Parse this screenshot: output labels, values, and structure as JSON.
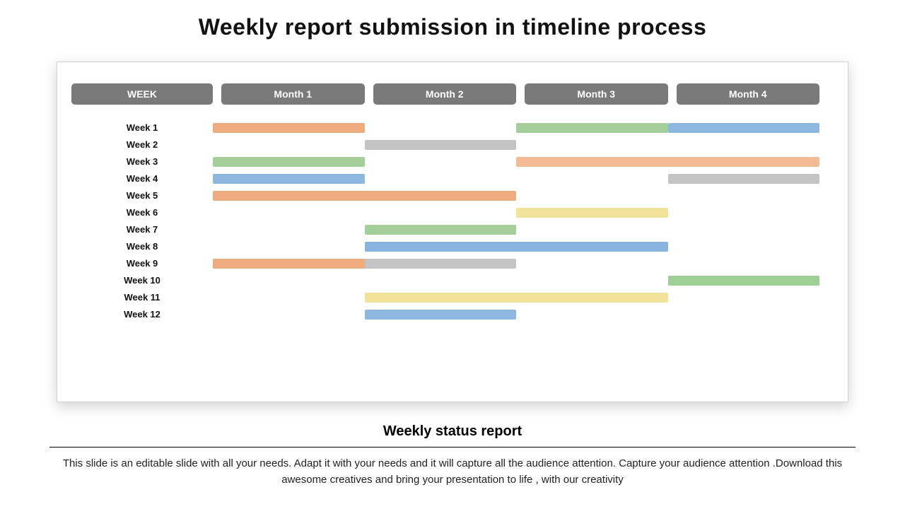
{
  "title": "Weekly report submission in timeline process",
  "headers": {
    "week": "WEEK",
    "m1": "Month 1",
    "m2": "Month 2",
    "m3": "Month 3",
    "m4": "Month 4"
  },
  "weeks": [
    "Week 1",
    "Week 2",
    "Week 3",
    "Week 4",
    "Week 5",
    "Week 6",
    "Week 7",
    "Week 8",
    "Week 9",
    "Week 10",
    "Week 11",
    "Week 12"
  ],
  "subtitle": "Weekly status report",
  "description": "This slide is an editable slide with all your needs. Adapt it with your needs and it will capture all the audience attention. Capture your audience attention .Download this awesome creatives and bring your presentation to life , with our creativity",
  "chart_data": {
    "type": "bar",
    "title": "Weekly report submission in timeline process",
    "xlabel": "",
    "ylabel": "",
    "xlim": [
      0,
      4
    ],
    "categories": [
      "Week 1",
      "Week 2",
      "Week 3",
      "Week 4",
      "Week 5",
      "Week 6",
      "Week 7",
      "Week 8",
      "Week 9",
      "Week 10",
      "Week 11",
      "Week 12"
    ],
    "columns": [
      "Month 1",
      "Month 2",
      "Month 3",
      "Month 4"
    ],
    "series": [
      {
        "name": "Week 1",
        "bars": [
          {
            "start": 0.0,
            "end": 1.0,
            "color": "orange"
          },
          {
            "start": 2.0,
            "end": 3.0,
            "color": "green"
          },
          {
            "start": 3.0,
            "end": 4.0,
            "color": "blue"
          }
        ]
      },
      {
        "name": "Week 2",
        "bars": [
          {
            "start": 1.0,
            "end": 2.0,
            "color": "gray"
          }
        ]
      },
      {
        "name": "Week 3",
        "bars": [
          {
            "start": 0.0,
            "end": 1.0,
            "color": "green"
          },
          {
            "start": 2.0,
            "end": 4.0,
            "color": "orange"
          }
        ]
      },
      {
        "name": "Week 4",
        "bars": [
          {
            "start": 0.0,
            "end": 1.0,
            "color": "blue"
          },
          {
            "start": 3.0,
            "end": 4.0,
            "color": "gray"
          }
        ]
      },
      {
        "name": "Week 5",
        "bars": [
          {
            "start": 0.0,
            "end": 2.0,
            "color": "orange"
          }
        ]
      },
      {
        "name": "Week 6",
        "bars": [
          {
            "start": 2.0,
            "end": 3.0,
            "color": "yellow"
          }
        ]
      },
      {
        "name": "Week 7",
        "bars": [
          {
            "start": 1.0,
            "end": 2.0,
            "color": "green"
          }
        ]
      },
      {
        "name": "Week 8",
        "bars": [
          {
            "start": 1.0,
            "end": 3.0,
            "color": "blue"
          }
        ]
      },
      {
        "name": "Week 9",
        "bars": [
          {
            "start": 0.0,
            "end": 2.0,
            "color": "gray"
          },
          {
            "start": 0.0,
            "end": 1.0,
            "color": "orange"
          }
        ]
      },
      {
        "name": "Week 10",
        "bars": [
          {
            "start": 3.0,
            "end": 4.0,
            "color": "green"
          }
        ]
      },
      {
        "name": "Week 11",
        "bars": [
          {
            "start": 1.0,
            "end": 3.0,
            "color": "yellow"
          }
        ]
      },
      {
        "name": "Week 12",
        "bars": [
          {
            "start": 1.0,
            "end": 2.0,
            "color": "blue"
          }
        ]
      }
    ]
  }
}
